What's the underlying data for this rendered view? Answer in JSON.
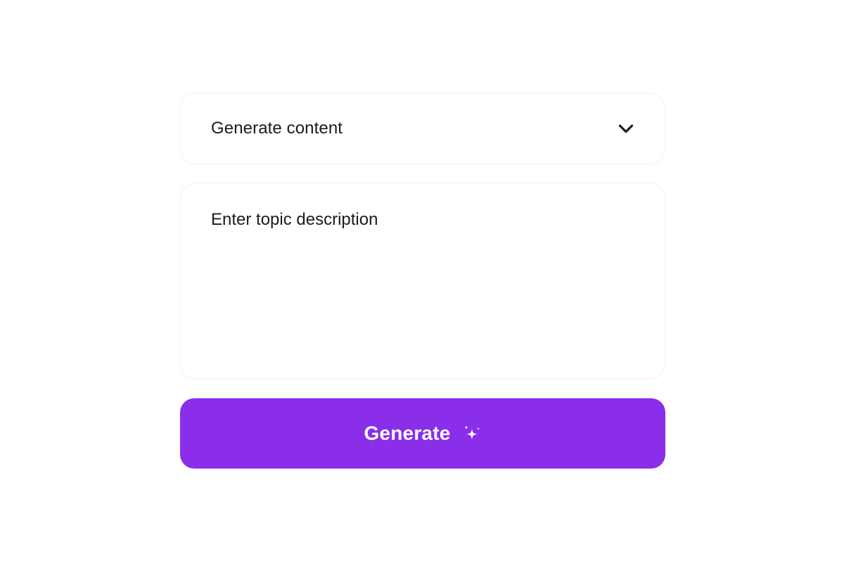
{
  "content_type_select": {
    "selected_label": "Generate content",
    "icon": "chevron-down-icon"
  },
  "topic": {
    "placeholder": "Enter topic description",
    "value": ""
  },
  "generate_button": {
    "label": "Generate",
    "icon": "sparkles-icon"
  },
  "colors": {
    "accent": "#8a2eea",
    "text": "#1b1b22",
    "background": "#ffffff",
    "border": "#f0f0f3"
  }
}
